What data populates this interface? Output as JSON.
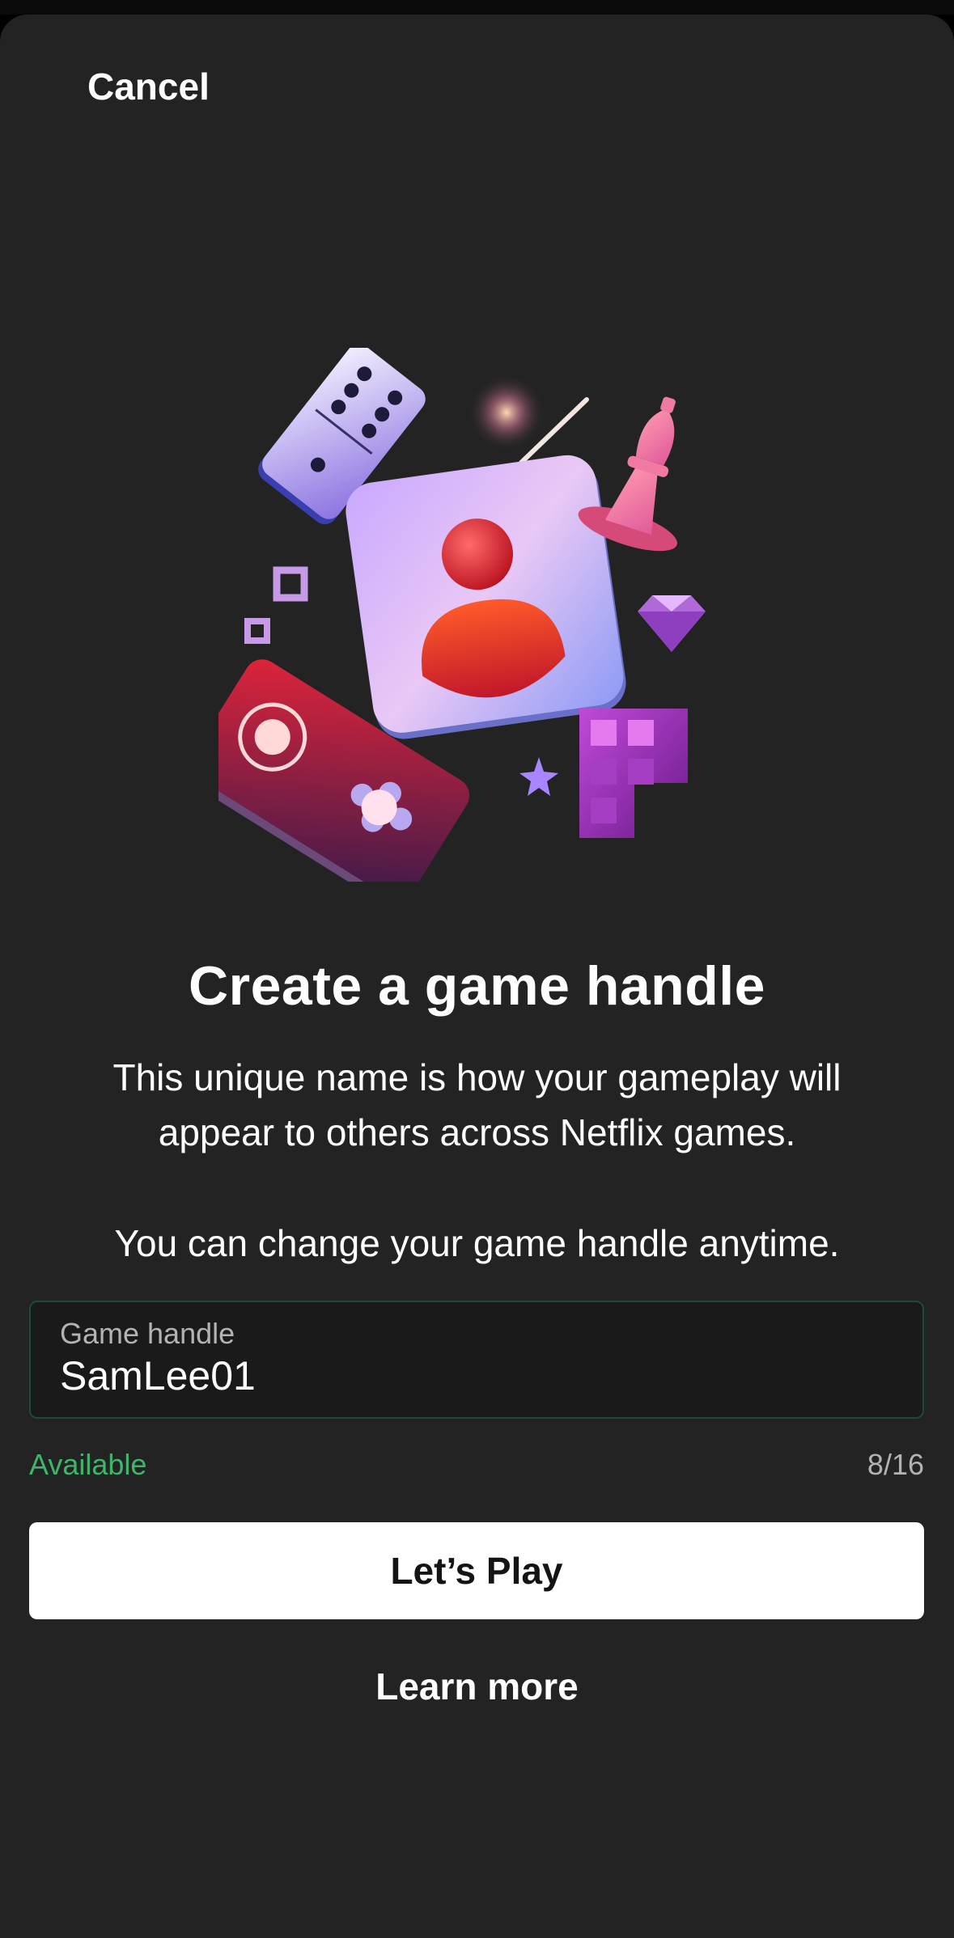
{
  "header": {
    "cancel_label": "Cancel"
  },
  "illustration": {
    "icon_name": "game-handle-illustration"
  },
  "main": {
    "title": "Create a game handle",
    "description": "This unique name is how your gameplay will appear to others across Netflix games.",
    "note": "You can change your game handle anytime."
  },
  "form": {
    "field_label": "Game handle",
    "field_value": "SamLee01",
    "status": "Available",
    "counter": "8/16"
  },
  "actions": {
    "play_label": "Let’s Play",
    "learn_more_label": "Learn more"
  },
  "colors": {
    "background": "#232323",
    "available": "#3db56a",
    "button": "#ffffff"
  }
}
